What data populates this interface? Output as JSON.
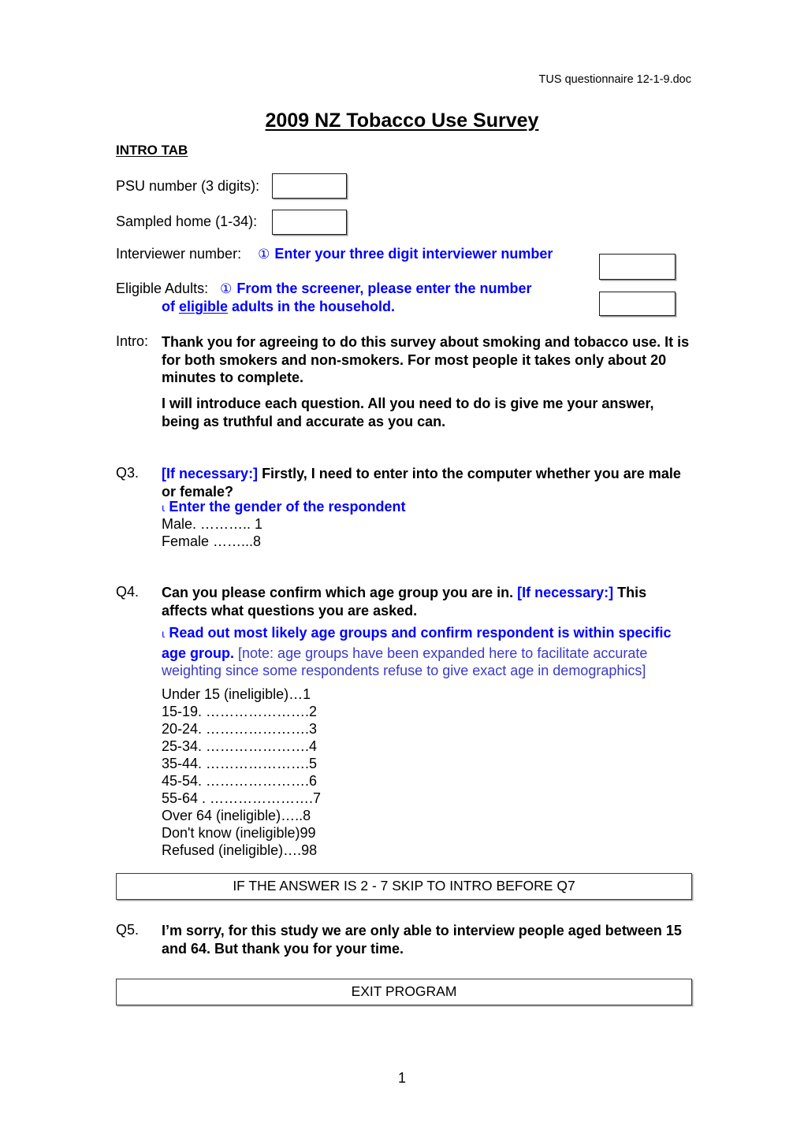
{
  "document": {
    "header_filename": "TUS questionnaire 12-1-9.doc",
    "title": "2009 NZ Tobacco Use Survey",
    "section_label": "INTRO TAB",
    "page_number": "1"
  },
  "glyphs": {
    "pointing_hand": "①",
    "small_marker": "ι"
  },
  "fields": {
    "psu": {
      "label": "PSU number (3 digits):",
      "value": ""
    },
    "sampled_home": {
      "label": "Sampled home (1-34):",
      "value": ""
    },
    "interviewer": {
      "label": "Interviewer number:",
      "instruction": "Enter your three digit interviewer number",
      "value": ""
    },
    "eligible_adults": {
      "label": "Eligible Adults:",
      "instruction_line1_a": "From the screener, please enter the number",
      "instruction_line2_a": "of ",
      "instruction_line2_underlined": "eligible",
      "instruction_line2_b": " adults in the household.",
      "value": ""
    }
  },
  "intro": {
    "label": "Intro:",
    "paragraph1": "Thank you for agreeing to do this survey about smoking and tobacco use.  It is for both smokers and non-smokers.  For most people it takes only about 20 minutes to complete.",
    "paragraph2": "I will introduce each question.  All you need to do is give me your answer, being as truthful and accurate as you can."
  },
  "questions": [
    {
      "id": "Q3",
      "label": "Q3.",
      "prompt_blue_prefix": "[If necessary:]",
      "prompt_text": "  Firstly, I need to enter into the computer whether you are male or female?",
      "interviewer_instruction": "Enter the gender of the respondent",
      "options": [
        "Male. ……….. 1",
        "Female ……...8"
      ]
    },
    {
      "id": "Q4",
      "label": "Q4.",
      "prompt_part1": "Can you please confirm which age group you are in.  ",
      "prompt_blue": "[If necessary:]",
      "prompt_part2": "  This affects what questions you are asked.",
      "instruction_bold": "Read out most likely age groups and confirm respondent is within specific age group.",
      "instruction_note": " [note: age groups have been expanded here to facilitate accurate weighting since some respondents refuse to give exact age in demographics]",
      "options": [
        "Under 15 (ineligible)…1",
        "15-19. ………………….2",
        "20-24. ………………….3",
        "25-34. ………………….4",
        "35-44. ………………….5",
        "45-54. ………………….6",
        "55-64 . ………………….7",
        "Over 64 (ineligible)…..8",
        "Don't know (ineligible)99",
        "Refused (ineligible)….98"
      ]
    },
    {
      "id": "Q5",
      "label": "Q5.",
      "prompt_text": "I’m sorry, for this study we are only able to interview people aged between 15 and 64.  But thank you for your time."
    }
  ],
  "instruction_boxes": [
    {
      "id": "skip-box",
      "text": "IF THE ANSWER IS 2 - 7 SKIP TO INTRO BEFORE Q7"
    },
    {
      "id": "exit-box",
      "text": "EXIT PROGRAM"
    }
  ],
  "colors": {
    "instruction_blue": "#0000FF",
    "note_blue": "#3A3AC8",
    "text_black": "#000000"
  }
}
